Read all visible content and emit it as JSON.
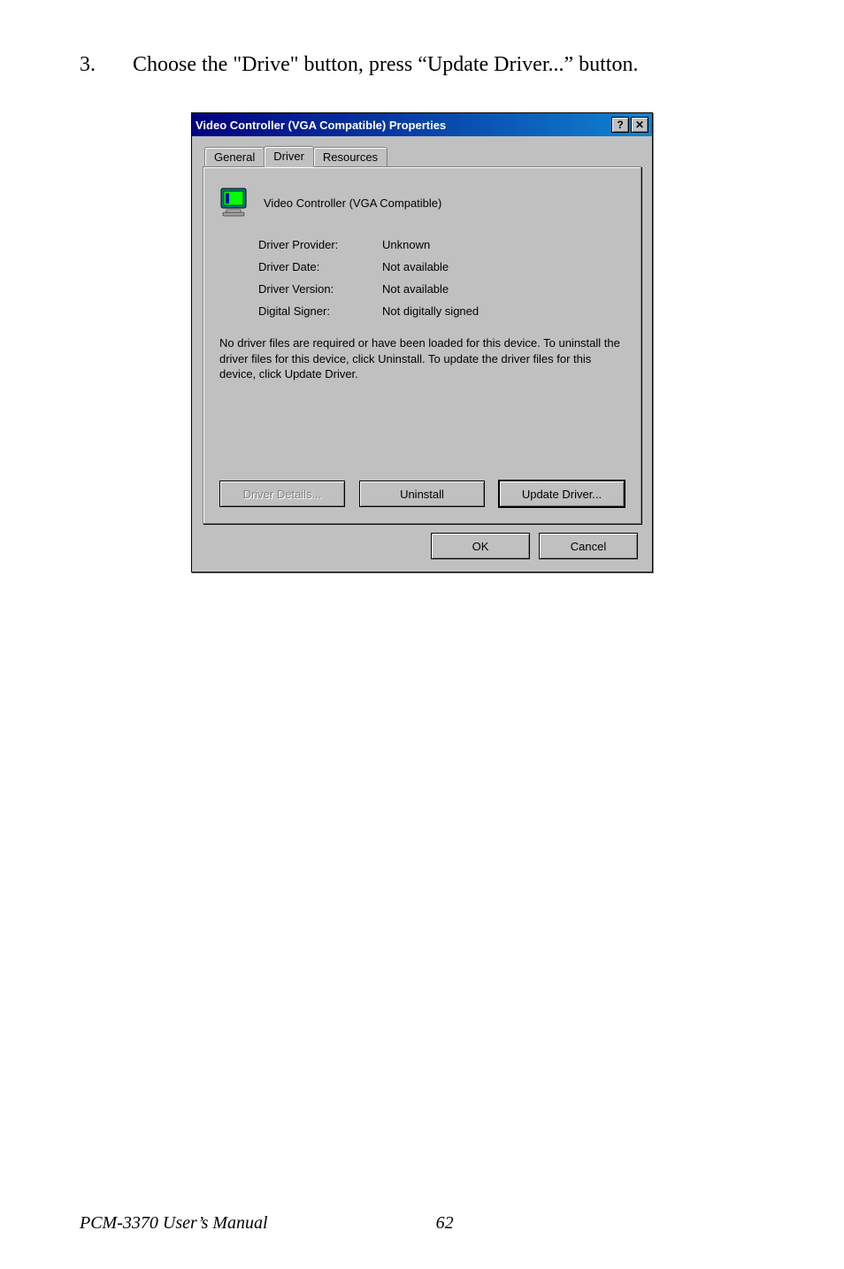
{
  "instruction": {
    "number": "3.",
    "text": "Choose the \"Drive\" button, press “Update Driver...” button."
  },
  "dialog": {
    "title": "Video Controller (VGA Compatible) Properties",
    "help_glyph": "?",
    "close_glyph": "✕",
    "tabs": {
      "general": "General",
      "driver": "Driver",
      "resources": "Resources"
    },
    "device_name": "Video Controller (VGA Compatible)",
    "props": {
      "provider_label": "Driver Provider:",
      "provider_value": "Unknown",
      "date_label": "Driver Date:",
      "date_value": "Not available",
      "version_label": "Driver Version:",
      "version_value": "Not available",
      "signer_label": "Digital Signer:",
      "signer_value": "Not digitally signed"
    },
    "description": "No driver files are required or have been loaded for this device. To uninstall the driver files for this device, click Uninstall. To update the driver files for this device, click Update Driver.",
    "buttons": {
      "details": "Driver Details...",
      "uninstall": "Uninstall",
      "update": "Update Driver...",
      "ok": "OK",
      "cancel": "Cancel"
    }
  },
  "footer": {
    "manual": "PCM-3370 User’s Manual",
    "page": "62"
  }
}
